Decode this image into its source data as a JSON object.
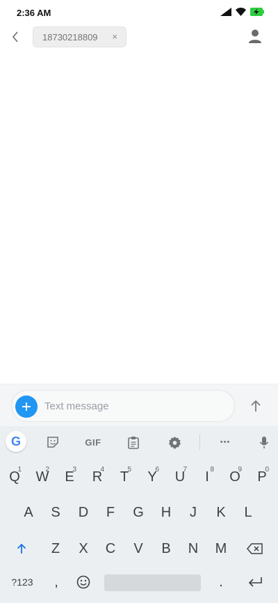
{
  "status_bar": {
    "time": "2:36 AM"
  },
  "header": {
    "recipient": "18730218809",
    "remove_symbol": "×"
  },
  "composer": {
    "placeholder": "Text message"
  },
  "keyboard": {
    "suggest": {
      "google": "G",
      "gif": "GIF",
      "more": "•••"
    },
    "row1": [
      {
        "char": "Q",
        "hint": "1"
      },
      {
        "char": "W",
        "hint": "2"
      },
      {
        "char": "E",
        "hint": "3"
      },
      {
        "char": "R",
        "hint": "4"
      },
      {
        "char": "T",
        "hint": "5"
      },
      {
        "char": "Y",
        "hint": "6"
      },
      {
        "char": "U",
        "hint": "7"
      },
      {
        "char": "I",
        "hint": "8"
      },
      {
        "char": "O",
        "hint": "9"
      },
      {
        "char": "P",
        "hint": "0"
      }
    ],
    "row2": [
      "A",
      "S",
      "D",
      "F",
      "G",
      "H",
      "J",
      "K",
      "L"
    ],
    "row3": [
      "Z",
      "X",
      "C",
      "V",
      "B",
      "N",
      "M"
    ],
    "row4": {
      "symbols": "?123",
      "comma": ",",
      "period": "."
    }
  }
}
